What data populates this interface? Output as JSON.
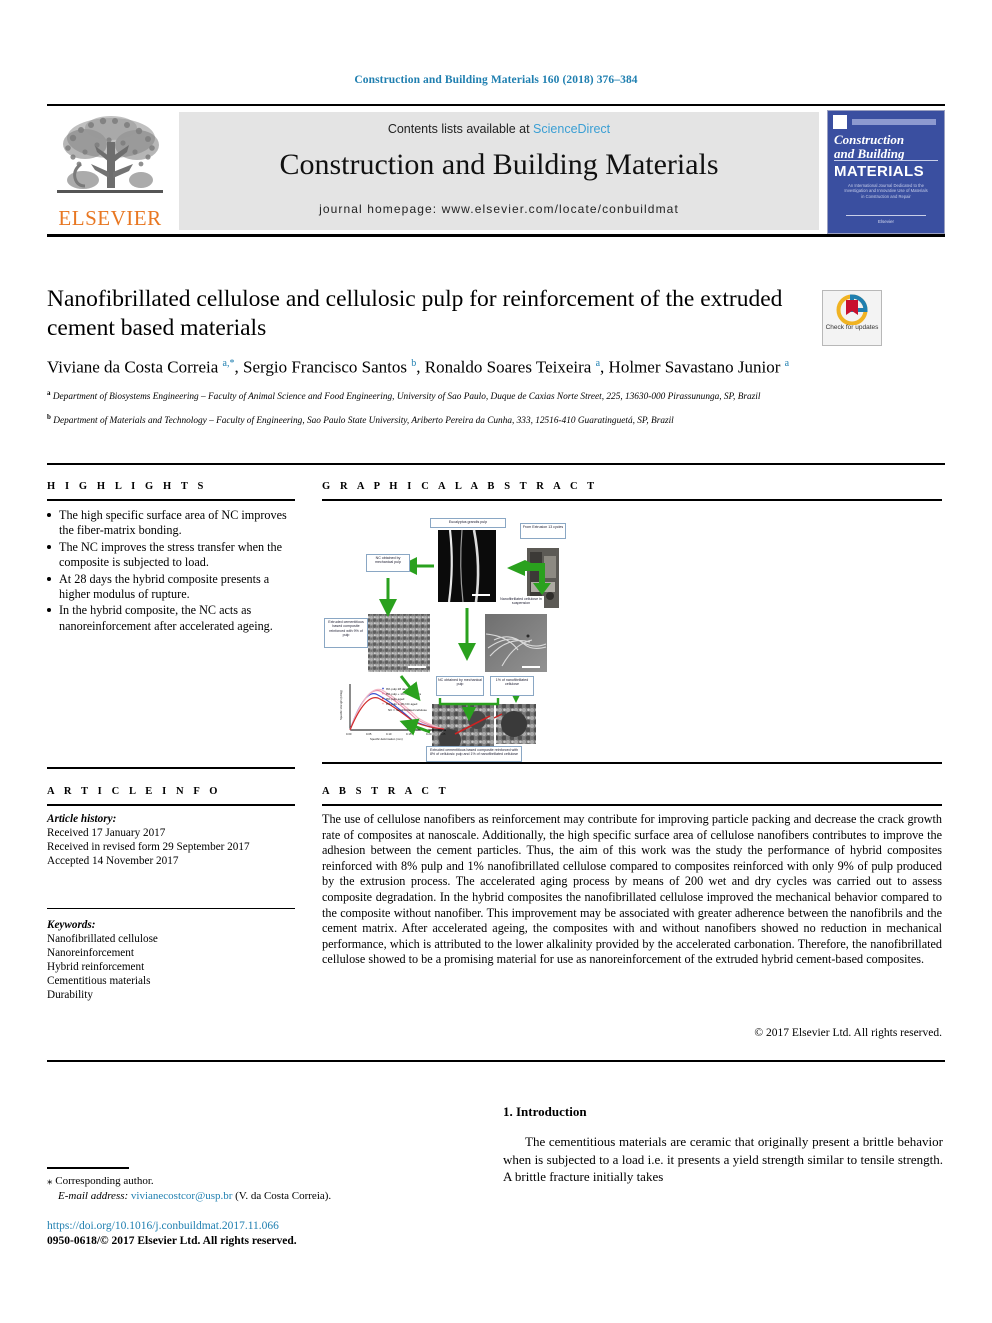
{
  "running_head": "Construction and Building Materials 160 (2018) 376–384",
  "masthead": {
    "publisher_name": "ELSEVIER",
    "contents_prefix": "Contents lists available at ",
    "contents_link": "ScienceDirect",
    "journal_title": "Construction and Building Materials",
    "homepage": "journal homepage: www.elsevier.com/locate/conbuildmat",
    "cover": {
      "line1": "Construction",
      "line2": "and Building",
      "line3": "MATERIALS",
      "blurb": "An International Journal Dedicated to the Investigation and Innovative Use of Materials in Construction and Repair",
      "bottom": "Elsevier"
    }
  },
  "article": {
    "title": "Nanofibrillated cellulose and cellulosic pulp for reinforcement of the extruded cement based materials",
    "crossmark_label": "Check for updates",
    "authors_html": "Viviane da Costa Correia <sup>a,*</sup>, Sergio Francisco Santos <sup>b</sup>, Ronaldo Soares Teixeira <sup>a</sup>, Holmer Savastano Junior <sup>a</sup>",
    "affiliation_a_html": "<sup>a</sup> Department of Biosystems Engineering – Faculty of Animal Science and Food Engineering, University of Sao Paulo, Duque de Caxias Norte Street, 225, 13630-000 Pirassununga, SP, Brazil",
    "affiliation_b_html": "<sup>b</sup> Department of Materials and Technology – Faculty of Engineering, Sao Paulo State University, Ariberto Pereira da Cunha, 333, 12516-410 Guaratinguetá, SP, Brazil"
  },
  "highlights": {
    "heading": "H I G H L I G H T S",
    "items": [
      "The high specific surface area of NC improves the fiber-matrix bonding.",
      "The NC improves the stress transfer when the composite is subjected to load.",
      "At 28 days the hybrid composite presents a higher modulus of rupture.",
      "In the hybrid composite, the NC acts as nanoreinforcement after accelerated ageing."
    ]
  },
  "graphical_abstract": {
    "heading": "G R A P H I C A L   A B S T R A C T",
    "labels": {
      "top_image": "Eucalyptus grandis pulp",
      "extruder": "From Extrusion 13 cycles",
      "refined_pulp": "NC obtained by mechanical pulp",
      "nanofibrillated": "Nanofibrillated cellulose in suspension",
      "composite_9pct": "Extruded cementitious based composite reinforced with 9% of pulp",
      "plus_left": "NC obtained by mechanical pulp",
      "plus_right": "1% of nanofibrillated cellulose",
      "bottom_caption": "Extruded cementitious based composite reinforced with 8% of cellulosic pulp and 1% of nanofibrillated cellulose"
    }
  },
  "article_info": {
    "heading": "A R T I C L E   I N F O",
    "history_label": "Article history:",
    "history": [
      "Received 17 January 2017",
      "Received in revised form 29 September 2017",
      "Accepted 14 November 2017"
    ],
    "keywords_label": "Keywords:",
    "keywords": [
      "Nanofibrillated cellulose",
      "Nanoreinforcement",
      "Hybrid reinforcement",
      "Cementitious materials",
      "Durability"
    ]
  },
  "abstract": {
    "heading": "A B S T R A C T",
    "text": "The use of cellulose nanofibers as reinforcement may contribute for improving particle packing and decrease the crack growth rate of composites at nanoscale. Additionally, the high specific surface area of cellulose nanofibers contributes to improve the adhesion between the cement particles. Thus, the aim of this work was the study the performance of hybrid composites reinforced with 8% pulp and 1% nanofibrillated cellulose compared to composites reinforced with only 9% of pulp produced by the extrusion process. The accelerated aging process by means of 200 wet and dry cycles was carried out to assess composite degradation. In the hybrid composites the nanofibrillated cellulose improved the mechanical behavior compared to the composite without nanofiber. This improvement may be associated with greater adherence between the nanofibrils and the cement matrix. After accelerated ageing, the composites with and without nanofibers showed no reduction in mechanical performance, which is attributed to the lower alkalinity provided by the accelerated carbonation. Therefore, the nanofibrillated cellulose showed to be a promising material for use as nanoreinforcement of the extruded hybrid cement-based composites.",
    "copyright": "© 2017 Elsevier Ltd. All rights reserved."
  },
  "introduction": {
    "heading": "1. Introduction",
    "text": "The cementitious materials are ceramic that originally present a brittle behavior when is subjected to a load i.e. it presents a yield strength similar to tensile strength. A brittle fracture initially takes"
  },
  "footer": {
    "corresponding_author": "⁎ Corresponding author.",
    "email_label": "E-mail address:",
    "email": "vivianecostcor@usp.br",
    "email_suffix": "(V. da Costa Correia).",
    "doi": "https://doi.org/10.1016/j.conbuildmat.2017.11.066",
    "issn": "0950-0618/© 2017 Elsevier Ltd. All rights reserved."
  },
  "colors": {
    "link_blue": "#1f7fb0",
    "sciencedirect_blue": "#3b9fd4",
    "elsevier_orange": "#e87722",
    "cover_blue": "#3a4fa0",
    "arrow_green": "#2aa11e"
  }
}
